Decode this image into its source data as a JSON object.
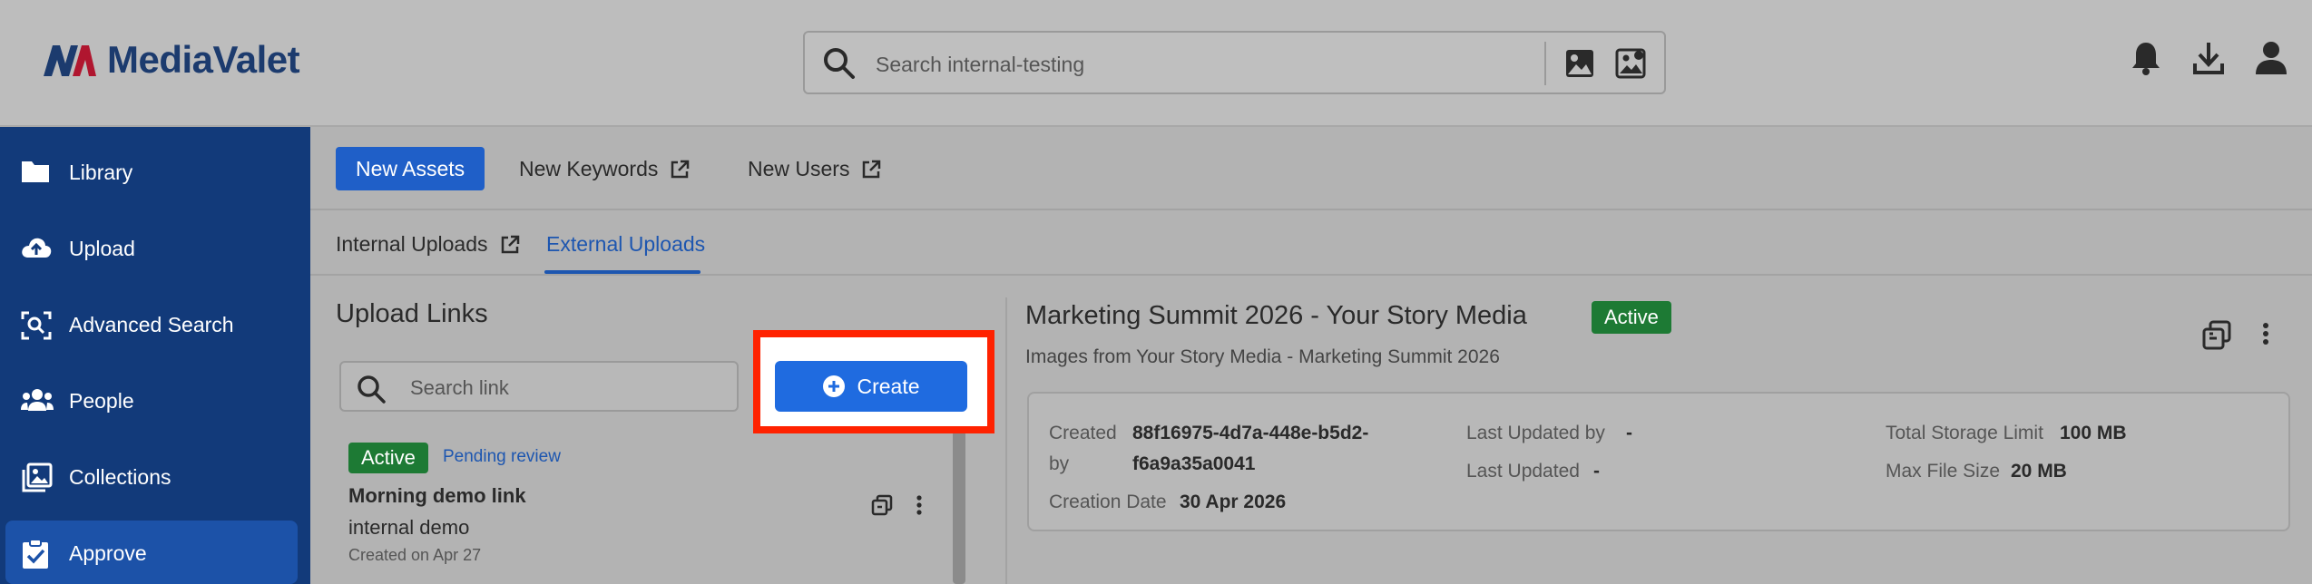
{
  "app": {
    "logo_text": "MediaValet"
  },
  "search": {
    "placeholder": "Search internal-testing"
  },
  "sidebar": {
    "items": [
      {
        "label": "Library",
        "icon": "folder-icon"
      },
      {
        "label": "Upload",
        "icon": "cloud-upload-icon"
      },
      {
        "label": "Advanced Search",
        "icon": "advanced-search-icon"
      },
      {
        "label": "People",
        "icon": "people-icon"
      },
      {
        "label": "Collections",
        "icon": "collections-icon"
      },
      {
        "label": "Approve",
        "icon": "clipboard-check-icon",
        "active": true
      }
    ]
  },
  "topbar": {
    "new_assets": "New Assets",
    "new_keywords": "New Keywords",
    "new_users": "New Users"
  },
  "tabs": {
    "internal": "Internal Uploads",
    "external": "External Uploads"
  },
  "links_panel": {
    "title": "Upload Links",
    "search_placeholder": "Search link",
    "create_label": "Create",
    "items": [
      {
        "status": "Active",
        "review": "Pending review",
        "title": "Morning demo link",
        "subtitle": "internal demo",
        "created": "Created on Apr 27"
      }
    ]
  },
  "detail": {
    "title": "Marketing Summit 2026 - Your Story Media",
    "status": "Active",
    "description": "Images from Your Story Media - Marketing Summit 2026",
    "created_by_label_1": "Created",
    "created_by_label_2": "by",
    "created_by_value_1": "88f16975-4d7a-448e-b5d2-",
    "created_by_value_2": "f6a9a35a0041",
    "creation_date_label": "Creation Date",
    "creation_date_value": "30 Apr 2026",
    "last_updated_by_label": "Last Updated by",
    "last_updated_by_value": "-",
    "last_updated_label": "Last Updated",
    "last_updated_value": "-",
    "total_storage_label": "Total Storage Limit",
    "total_storage_value": "100 MB",
    "max_file_label": "Max File Size",
    "max_file_value": "20 MB"
  },
  "colors": {
    "brand_blue": "#1f5fc8",
    "sidebar_bg": "#123a7a",
    "active_green": "#1d7a34",
    "highlight_red": "#ff2200"
  }
}
